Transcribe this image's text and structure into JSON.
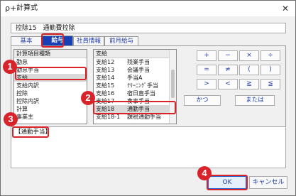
{
  "window": {
    "title": "計算式",
    "app_icon": "function-icon",
    "close_glyph": "✕"
  },
  "expression_header": "控除15　通勤費控除",
  "tabs": [
    {
      "label": "基本",
      "active": false
    },
    {
      "label": "給与",
      "active": true
    },
    {
      "label": "社員情報",
      "active": false
    },
    {
      "label": "前月給与",
      "active": false
    }
  ],
  "category_list": {
    "header": "計算項目種類",
    "items": [
      {
        "label": "勤怠",
        "selected": false
      },
      {
        "label": "勤怠手当",
        "selected": false
      },
      {
        "label": "支給",
        "selected": true
      },
      {
        "label": "支給内訳",
        "selected": false
      },
      {
        "label": "控除",
        "selected": false
      },
      {
        "label": "控除内訳",
        "selected": false
      },
      {
        "label": "計算",
        "selected": false
      },
      {
        "label": "事業主",
        "selected": false
      }
    ]
  },
  "item_list": {
    "header": "支給",
    "rows": [
      {
        "code": "支給12",
        "name": "残業手当",
        "selected": false
      },
      {
        "code": "支給13",
        "name": "会議手当",
        "selected": false
      },
      {
        "code": "支給14",
        "name": "手当A",
        "selected": false
      },
      {
        "code": "支給15",
        "name": "ｸﾘｰﾆﾝｸﾞ手当",
        "selected": false
      },
      {
        "code": "支給16",
        "name": "宿日直手当",
        "selected": false
      },
      {
        "code": "支給17",
        "name": "食事手当",
        "selected": false
      },
      {
        "code": "支給18",
        "name": "通勤手当",
        "selected": true
      },
      {
        "code": "支給18-1",
        "name": "課税通勤手当",
        "selected": false
      }
    ]
  },
  "operators": {
    "row1": [
      "+",
      "−",
      "×",
      "÷"
    ],
    "row2": [
      "=",
      "≠",
      "(",
      ")"
    ],
    "row3": [
      ">",
      "<",
      "≧",
      "≦"
    ],
    "and_label": "かつ",
    "or_label": "または"
  },
  "selected_item_label": "【通勤手当】",
  "buttons": {
    "ok": "OK",
    "cancel": "キャンセル"
  },
  "callouts": [
    "1",
    "2",
    "3",
    "4"
  ],
  "colors": {
    "accent": "#1840b4",
    "callout": "#d8232a",
    "link_text": "#1f3ea8"
  }
}
